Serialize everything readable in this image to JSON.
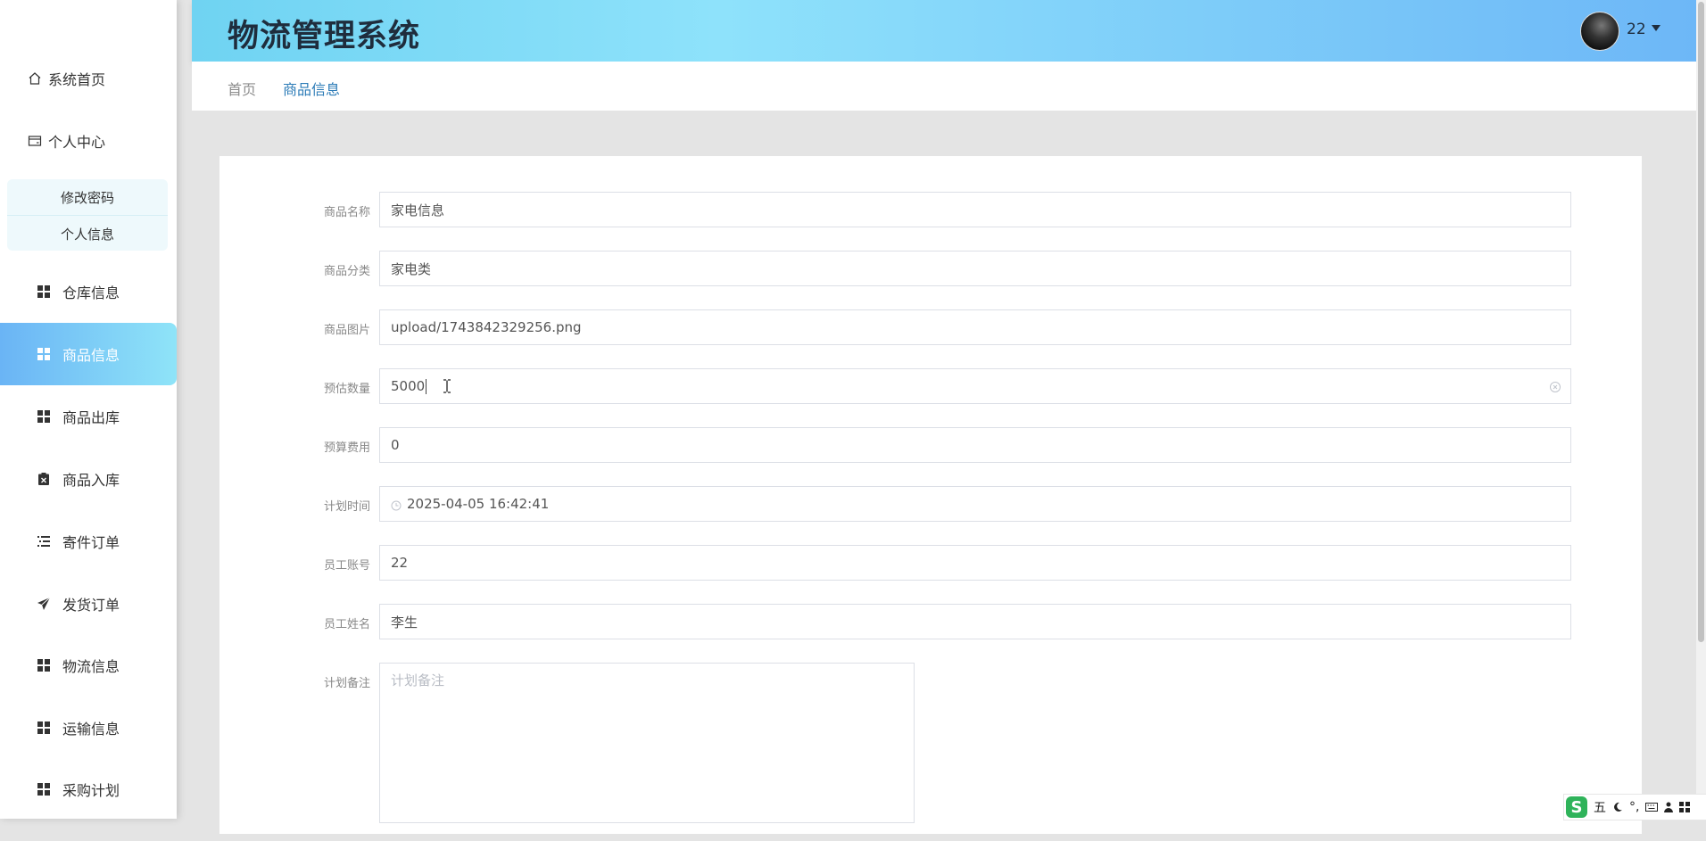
{
  "app": {
    "title": "物流管理系统"
  },
  "user": {
    "name": "22"
  },
  "sidebar": {
    "items": [
      {
        "label": "系统首页",
        "icon": "home-icon"
      },
      {
        "label": "个人中心",
        "icon": "wallet-icon"
      },
      {
        "label": "仓库信息",
        "icon": "grid-icon"
      },
      {
        "label": "商品信息",
        "icon": "grid-icon",
        "active": true
      },
      {
        "label": "商品出库",
        "icon": "grid-icon"
      },
      {
        "label": "商品入库",
        "icon": "clipboard-x-icon"
      },
      {
        "label": "寄件订单",
        "icon": "list-icon"
      },
      {
        "label": "发货订单",
        "icon": "paper-plane-icon"
      },
      {
        "label": "物流信息",
        "icon": "grid-icon"
      },
      {
        "label": "运输信息",
        "icon": "grid-icon"
      },
      {
        "label": "采购计划",
        "icon": "grid-icon"
      }
    ],
    "submenu": [
      {
        "label": "修改密码"
      },
      {
        "label": "个人信息"
      }
    ]
  },
  "breadcrumb": {
    "home": "首页",
    "current": "商品信息"
  },
  "form": {
    "fields": [
      {
        "label": "商品名称",
        "value": "家电信息"
      },
      {
        "label": "商品分类",
        "value": "家电类"
      },
      {
        "label": "商品图片",
        "value": "upload/1743842329256.png"
      },
      {
        "label": "预估数量",
        "value": "5000"
      },
      {
        "label": "预算费用",
        "value": "0"
      },
      {
        "label": "计划时间",
        "value": "2025-04-05 16:42:41"
      },
      {
        "label": "员工账号",
        "value": "22"
      },
      {
        "label": "员工姓名",
        "value": "李生"
      }
    ],
    "remark": {
      "label": "计划备注",
      "placeholder": "计划备注"
    }
  },
  "ime": {
    "logo": "S",
    "mode": "五",
    "punct": "°,"
  },
  "colors": {
    "header_start": "#6fd3f2",
    "header_end": "#6db7f7",
    "active_nav_start": "#6ab4f5",
    "active_nav_end": "#8fe4f8",
    "breadcrumb_active": "#2b7bb7",
    "ime_brand": "#2fb35a"
  }
}
